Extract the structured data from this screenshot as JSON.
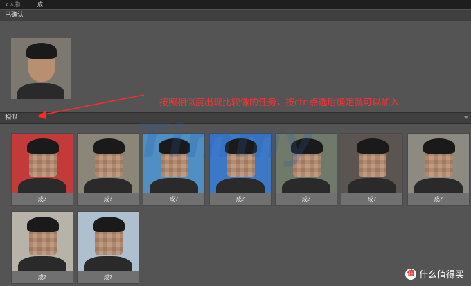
{
  "topbar": {
    "back_label": "人物",
    "current": "成"
  },
  "sections": {
    "confirmed_title": "已确认",
    "similar_title": "相似"
  },
  "similar_tiles": [
    {
      "label": "成?",
      "bg": "#c33a3a"
    },
    {
      "label": "成?",
      "bg": "#8a8678"
    },
    {
      "label": "成?",
      "bg": "#4f8fc4"
    },
    {
      "label": "成?",
      "bg": "#3b78c8"
    },
    {
      "label": "成?",
      "bg": "#6f7a6a"
    },
    {
      "label": "成?",
      "bg": "#5a5550"
    },
    {
      "label": "成?",
      "bg": "#8d8a82"
    },
    {
      "label": "成?",
      "bg": "#b7b3a8"
    },
    {
      "label": "成?",
      "bg": "#aebfd0"
    }
  ],
  "annotation": "按照相似度出现比较像的任务，按ctrl点选后确定就可以加入",
  "watermark": "Timmy",
  "site_logo": {
    "badge": "值",
    "text": "什么值得买"
  }
}
